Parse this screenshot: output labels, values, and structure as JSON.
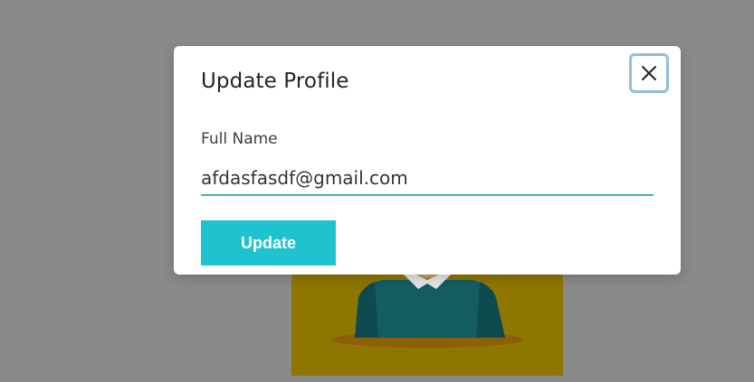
{
  "modal": {
    "title": "Update Profile",
    "close_icon": "close-icon",
    "field": {
      "label": "Full Name",
      "value": "afdasfasdf@gmail.com",
      "placeholder": ""
    },
    "submit_label": "Update"
  },
  "colors": {
    "overlay": "#8a8a8a",
    "accent": "#20c2cf",
    "input_underline": "#3fb1b9",
    "focus_ring": "#8fbde3",
    "avatar_background": "#8e7600",
    "avatar_shirt": "#135a60"
  },
  "background": {
    "avatar_icon": "person-avatar-illustration"
  }
}
